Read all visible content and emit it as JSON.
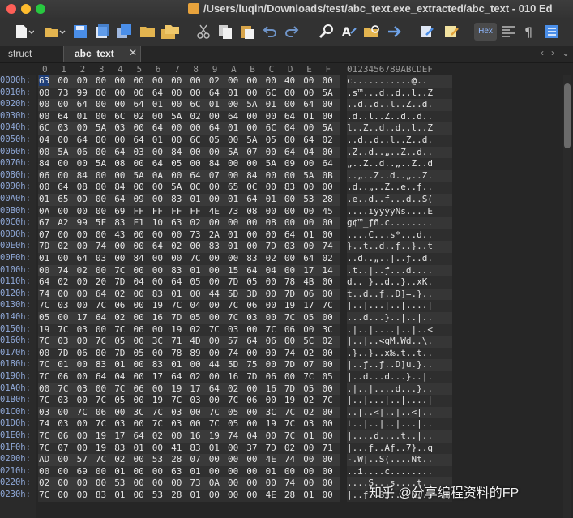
{
  "window": {
    "title": "/Users/luqin/Downloads/test/abc_text.exe_extracted/abc_text - 010 Ed"
  },
  "toolbar": {
    "hex_label": "Hex",
    "icons": [
      "new-file-icon",
      "open-folder-icon",
      "save-icon",
      "save-as-icon",
      "save-all-icon",
      "folder-icon",
      "folders-icon",
      "cut-icon",
      "copy-icon",
      "paste-icon",
      "undo-icon",
      "redo-icon",
      "find-icon",
      "replace-icon",
      "find-in-files-icon",
      "goto-icon",
      "compare-icon",
      "tag-icon",
      "hex-mode-icon",
      "columns-icon",
      "paragraph-icon",
      "list-icon"
    ]
  },
  "tabs": {
    "struct_label": "struct",
    "active_label": "abc_text",
    "close": "✕",
    "nav_prev": "‹",
    "nav_next": "›",
    "nav_menu": "⌄"
  },
  "hex": {
    "columns": [
      "0",
      "1",
      "2",
      "3",
      "4",
      "5",
      "6",
      "7",
      "8",
      "9",
      "A",
      "B",
      "C",
      "D",
      "E",
      "F"
    ],
    "ascii_header": "0123456789ABCDEF",
    "rows": [
      {
        "addr": "0000h:",
        "bytes": [
          "63",
          "00",
          "00",
          "00",
          "00",
          "00",
          "00",
          "00",
          "00",
          "02",
          "00",
          "00",
          "00",
          "40",
          "00",
          "00"
        ],
        "ascii": "c...........@.."
      },
      {
        "addr": "0010h:",
        "bytes": [
          "00",
          "73",
          "99",
          "00",
          "00",
          "00",
          "64",
          "00",
          "00",
          "64",
          "01",
          "00",
          "6C",
          "00",
          "00",
          "5A"
        ],
        "ascii": ".s™...d..d..l..Z"
      },
      {
        "addr": "0020h:",
        "bytes": [
          "00",
          "00",
          "64",
          "00",
          "00",
          "64",
          "01",
          "00",
          "6C",
          "01",
          "00",
          "5A",
          "01",
          "00",
          "64",
          "00"
        ],
        "ascii": "..d..d..l..Z..d."
      },
      {
        "addr": "0030h:",
        "bytes": [
          "00",
          "64",
          "01",
          "00",
          "6C",
          "02",
          "00",
          "5A",
          "02",
          "00",
          "64",
          "00",
          "00",
          "64",
          "01",
          "00"
        ],
        "ascii": ".d..l..Z..d..d.."
      },
      {
        "addr": "0040h:",
        "bytes": [
          "6C",
          "03",
          "00",
          "5A",
          "03",
          "00",
          "64",
          "00",
          "00",
          "64",
          "01",
          "00",
          "6C",
          "04",
          "00",
          "5A"
        ],
        "ascii": "l..Z..d..d..l..Z"
      },
      {
        "addr": "0050h:",
        "bytes": [
          "04",
          "00",
          "64",
          "00",
          "00",
          "64",
          "01",
          "00",
          "6C",
          "05",
          "00",
          "5A",
          "05",
          "00",
          "64",
          "02"
        ],
        "ascii": "..d..d..l..Z..d."
      },
      {
        "addr": "0060h:",
        "bytes": [
          "00",
          "5A",
          "06",
          "00",
          "64",
          "03",
          "00",
          "84",
          "00",
          "00",
          "5A",
          "07",
          "00",
          "64",
          "04",
          "00"
        ],
        "ascii": ".Z..d..„..Z..d.."
      },
      {
        "addr": "0070h:",
        "bytes": [
          "84",
          "00",
          "00",
          "5A",
          "08",
          "00",
          "64",
          "05",
          "00",
          "84",
          "00",
          "00",
          "5A",
          "09",
          "00",
          "64"
        ],
        "ascii": "„..Z..d..„..Z..d"
      },
      {
        "addr": "0080h:",
        "bytes": [
          "06",
          "00",
          "84",
          "00",
          "00",
          "5A",
          "0A",
          "00",
          "64",
          "07",
          "00",
          "84",
          "00",
          "00",
          "5A",
          "0B"
        ],
        "ascii": "..„..Z..d..„..Z."
      },
      {
        "addr": "0090h:",
        "bytes": [
          "00",
          "64",
          "08",
          "00",
          "84",
          "00",
          "00",
          "5A",
          "0C",
          "00",
          "65",
          "0C",
          "00",
          "83",
          "00",
          "00"
        ],
        "ascii": ".d..„..Z..e..ƒ.."
      },
      {
        "addr": "00A0h:",
        "bytes": [
          "01",
          "65",
          "0D",
          "00",
          "64",
          "09",
          "00",
          "83",
          "01",
          "00",
          "01",
          "64",
          "01",
          "00",
          "53",
          "28"
        ],
        "ascii": ".e..d..ƒ...d..S("
      },
      {
        "addr": "00B0h:",
        "bytes": [
          "0A",
          "00",
          "00",
          "00",
          "69",
          "FF",
          "FF",
          "FF",
          "FF",
          "4E",
          "73",
          "08",
          "00",
          "00",
          "00",
          "45"
        ],
        "ascii": "....iÿÿÿÿNs....E"
      },
      {
        "addr": "00C0h:",
        "bytes": [
          "67",
          "A2",
          "99",
          "5F",
          "83",
          "F1",
          "10",
          "63",
          "02",
          "00",
          "00",
          "00",
          "08",
          "00",
          "00",
          "00"
        ],
        "ascii": "g¢™_ƒñ.c........"
      },
      {
        "addr": "00D0h:",
        "bytes": [
          "07",
          "00",
          "00",
          "00",
          "43",
          "00",
          "00",
          "00",
          "73",
          "2A",
          "01",
          "00",
          "00",
          "64",
          "01",
          "00"
        ],
        "ascii": "....C...s*...d.."
      },
      {
        "addr": "00E0h:",
        "bytes": [
          "7D",
          "02",
          "00",
          "74",
          "00",
          "00",
          "64",
          "02",
          "00",
          "83",
          "01",
          "00",
          "7D",
          "03",
          "00",
          "74"
        ],
        "ascii": "}..t..d..ƒ..}..t"
      },
      {
        "addr": "00F0h:",
        "bytes": [
          "01",
          "00",
          "64",
          "03",
          "00",
          "84",
          "00",
          "00",
          "7C",
          "00",
          "00",
          "83",
          "02",
          "00",
          "64",
          "02"
        ],
        "ascii": "..d..„..|..ƒ..d."
      },
      {
        "addr": "0100h:",
        "bytes": [
          "00",
          "74",
          "02",
          "00",
          "7C",
          "00",
          "00",
          "83",
          "01",
          "00",
          "15",
          "64",
          "04",
          "00",
          "17",
          "14"
        ],
        "ascii": ".t..|..ƒ...d...."
      },
      {
        "addr": "0110h:",
        "bytes": [
          "64",
          "02",
          "00",
          "20",
          "7D",
          "04",
          "00",
          "64",
          "05",
          "00",
          "7D",
          "05",
          "00",
          "78",
          "4B",
          "00"
        ],
        "ascii": "d.. }..d..}..xK."
      },
      {
        "addr": "0120h:",
        "bytes": [
          "74",
          "00",
          "00",
          "64",
          "02",
          "00",
          "83",
          "01",
          "00",
          "44",
          "5D",
          "3D",
          "00",
          "7D",
          "06",
          "00"
        ],
        "ascii": "t..d..ƒ..D]=.}.."
      },
      {
        "addr": "0130h:",
        "bytes": [
          "7C",
          "03",
          "00",
          "7C",
          "06",
          "00",
          "19",
          "7C",
          "04",
          "00",
          "7C",
          "06",
          "00",
          "19",
          "17",
          "7C"
        ],
        "ascii": "|..|...|..|....|"
      },
      {
        "addr": "0140h:",
        "bytes": [
          "05",
          "00",
          "17",
          "64",
          "02",
          "00",
          "16",
          "7D",
          "05",
          "00",
          "7C",
          "03",
          "00",
          "7C",
          "05",
          "00"
        ],
        "ascii": "...d...}..|..|.."
      },
      {
        "addr": "0150h:",
        "bytes": [
          "19",
          "7C",
          "03",
          "00",
          "7C",
          "06",
          "00",
          "19",
          "02",
          "7C",
          "03",
          "00",
          "7C",
          "06",
          "00",
          "3C"
        ],
        "ascii": ".|..|....|..|..<"
      },
      {
        "addr": "0160h:",
        "bytes": [
          "7C",
          "03",
          "00",
          "7C",
          "05",
          "00",
          "3C",
          "71",
          "4D",
          "00",
          "57",
          "64",
          "06",
          "00",
          "5C",
          "02"
        ],
        "ascii": "|..|..<qM.Wd..\\."
      },
      {
        "addr": "0170h:",
        "bytes": [
          "00",
          "7D",
          "06",
          "00",
          "7D",
          "05",
          "00",
          "78",
          "89",
          "00",
          "74",
          "00",
          "00",
          "74",
          "02",
          "00"
        ],
        "ascii": ".}..}..x‰.t..t.."
      },
      {
        "addr": "0180h:",
        "bytes": [
          "7C",
          "01",
          "00",
          "83",
          "01",
          "00",
          "83",
          "01",
          "00",
          "44",
          "5D",
          "75",
          "00",
          "7D",
          "07",
          "00"
        ],
        "ascii": "|..ƒ..ƒ..D]u.}.."
      },
      {
        "addr": "0190h:",
        "bytes": [
          "7C",
          "06",
          "00",
          "64",
          "04",
          "00",
          "17",
          "64",
          "02",
          "00",
          "16",
          "7D",
          "06",
          "00",
          "7C",
          "05"
        ],
        "ascii": "|..d...d...}..|."
      },
      {
        "addr": "01A0h:",
        "bytes": [
          "00",
          "7C",
          "03",
          "00",
          "7C",
          "06",
          "00",
          "19",
          "17",
          "64",
          "02",
          "00",
          "16",
          "7D",
          "05",
          "00"
        ],
        "ascii": ".|..|....d...}.."
      },
      {
        "addr": "01B0h:",
        "bytes": [
          "7C",
          "03",
          "00",
          "7C",
          "05",
          "00",
          "19",
          "7C",
          "03",
          "00",
          "7C",
          "06",
          "00",
          "19",
          "02",
          "7C"
        ],
        "ascii": "|..|...|..|....|"
      },
      {
        "addr": "01C0h:",
        "bytes": [
          "03",
          "00",
          "7C",
          "06",
          "00",
          "3C",
          "7C",
          "03",
          "00",
          "7C",
          "05",
          "00",
          "3C",
          "7C",
          "02",
          "00"
        ],
        "ascii": "..|..<|..|..<|.."
      },
      {
        "addr": "01D0h:",
        "bytes": [
          "74",
          "03",
          "00",
          "7C",
          "03",
          "00",
          "7C",
          "03",
          "00",
          "7C",
          "05",
          "00",
          "19",
          "7C",
          "03",
          "00"
        ],
        "ascii": "t..|..|..|...|.."
      },
      {
        "addr": "01E0h:",
        "bytes": [
          "7C",
          "06",
          "00",
          "19",
          "17",
          "64",
          "02",
          "00",
          "16",
          "19",
          "74",
          "04",
          "00",
          "7C",
          "01",
          "00"
        ],
        "ascii": "|....d....t..|.."
      },
      {
        "addr": "01F0h:",
        "bytes": [
          "7C",
          "07",
          "00",
          "19",
          "83",
          "01",
          "00",
          "41",
          "83",
          "01",
          "00",
          "37",
          "7D",
          "02",
          "00",
          "71"
        ],
        "ascii": "|...ƒ..Aƒ..7}..q"
      },
      {
        "addr": "0200h:",
        "bytes": [
          "AD",
          "00",
          "57",
          "7C",
          "02",
          "00",
          "53",
          "28",
          "07",
          "00",
          "00",
          "00",
          "4E",
          "74",
          "00",
          "00"
        ],
        "ascii": "-.W|..S(....Nt.."
      },
      {
        "addr": "0210h:",
        "bytes": [
          "00",
          "00",
          "69",
          "00",
          "01",
          "00",
          "00",
          "63",
          "01",
          "00",
          "00",
          "00",
          "01",
          "00",
          "00",
          "00"
        ],
        "ascii": "..i....c........"
      },
      {
        "addr": "0220h:",
        "bytes": [
          "02",
          "00",
          "00",
          "00",
          "53",
          "00",
          "00",
          "00",
          "73",
          "0A",
          "00",
          "00",
          "00",
          "74",
          "00",
          "00"
        ],
        "ascii": "....S...s....t.."
      },
      {
        "addr": "0230h:",
        "bytes": [
          "7C",
          "00",
          "00",
          "83",
          "01",
          "00",
          "53",
          "28",
          "01",
          "00",
          "00",
          "00",
          "4E",
          "28",
          "01",
          "00"
        ],
        "ascii": "|..ƒ..S(....N(.."
      }
    ]
  },
  "watermark": "知乎 @分享编程资料的FP"
}
